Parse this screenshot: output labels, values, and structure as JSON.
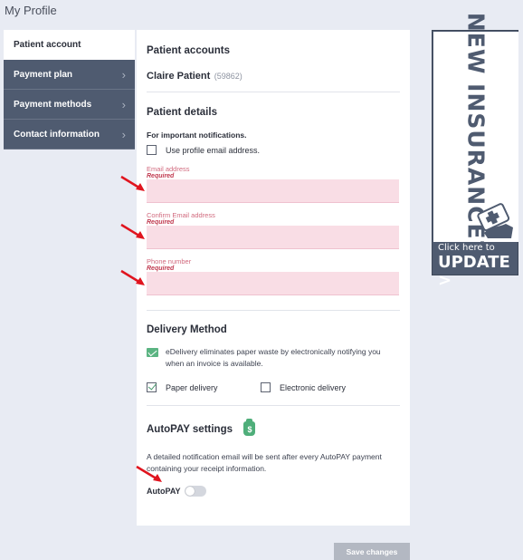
{
  "page": {
    "title": "My Profile"
  },
  "sidebar": {
    "items": [
      {
        "label": "Patient account",
        "active": true
      },
      {
        "label": "Payment plan",
        "active": false
      },
      {
        "label": "Payment methods",
        "active": false
      },
      {
        "label": "Contact information",
        "active": false
      }
    ]
  },
  "patient_accounts": {
    "heading": "Patient accounts",
    "name": "Claire Patient",
    "id": "(59862)"
  },
  "patient_details": {
    "heading": "Patient details",
    "notice": "For important notifications.",
    "use_profile_email_label": "Use profile email address.",
    "fields": [
      {
        "label": "Email address",
        "required": "Required",
        "value": ""
      },
      {
        "label": "Confirm Email address",
        "required": "Required",
        "value": ""
      },
      {
        "label": "Phone number",
        "required": "Required",
        "value": ""
      }
    ]
  },
  "delivery": {
    "heading": "Delivery Method",
    "description": "eDelivery eliminates paper waste by electronically notifying you when an invoice is available.",
    "options": [
      {
        "label": "Paper delivery",
        "checked": true
      },
      {
        "label": "Electronic delivery",
        "checked": false
      }
    ]
  },
  "autopay": {
    "heading": "AutoPAY settings",
    "icon": "money-bag-icon",
    "description": "A detailed notification email will be sent after every AutoPAY payment containing your receipt information.",
    "toggle_label": "AutoPAY",
    "enabled": false
  },
  "actions": {
    "save_label": "Save changes"
  },
  "ad": {
    "title": "NEW INSURANCE?",
    "click_text": "Click here to",
    "update_text": "UPDATE >"
  },
  "colors": {
    "sidebar_bg": "#4f5b70",
    "required_field_bg": "#f9dde5",
    "required_label": "#d16a7e",
    "arrow": "#e0141e",
    "accent_green": "#4fae7a"
  }
}
